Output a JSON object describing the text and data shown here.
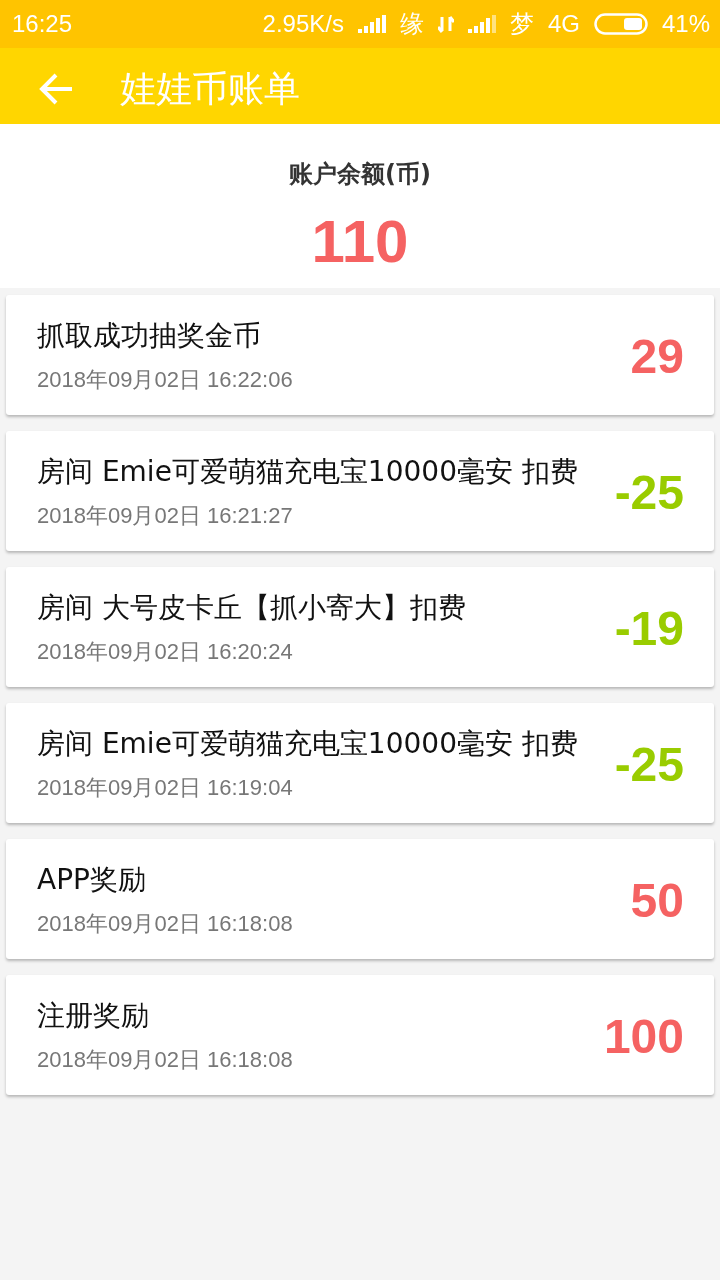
{
  "status_bar": {
    "time": "16:25",
    "speed": "2.95K/s",
    "carrier_1": "缘",
    "carrier_2": "梦",
    "network": "4G",
    "battery": "41%"
  },
  "app_bar": {
    "title": "娃娃币账单"
  },
  "balance": {
    "label": "账户余额(币)",
    "value": "110"
  },
  "records": [
    {
      "title": "抓取成功抽奖金币",
      "time": "2018年09月02日 16:22:06",
      "amount": "29",
      "kind": "credit"
    },
    {
      "title": "房间 Emie可爱萌猫充电宝10000毫安 扣费",
      "time": "2018年09月02日 16:21:27",
      "amount": "-25",
      "kind": "debit"
    },
    {
      "title": "房间 大号皮卡丘【抓小寄大】扣费",
      "time": "2018年09月02日 16:20:24",
      "amount": "-19",
      "kind": "debit"
    },
    {
      "title": "房间 Emie可爱萌猫充电宝10000毫安 扣费",
      "time": "2018年09月02日 16:19:04",
      "amount": "-25",
      "kind": "debit"
    },
    {
      "title": "APP奖励",
      "time": "2018年09月02日 16:18:08",
      "amount": "50",
      "kind": "credit"
    },
    {
      "title": "注册奖励",
      "time": "2018年09月02日 16:18:08",
      "amount": "100",
      "kind": "credit"
    }
  ]
}
